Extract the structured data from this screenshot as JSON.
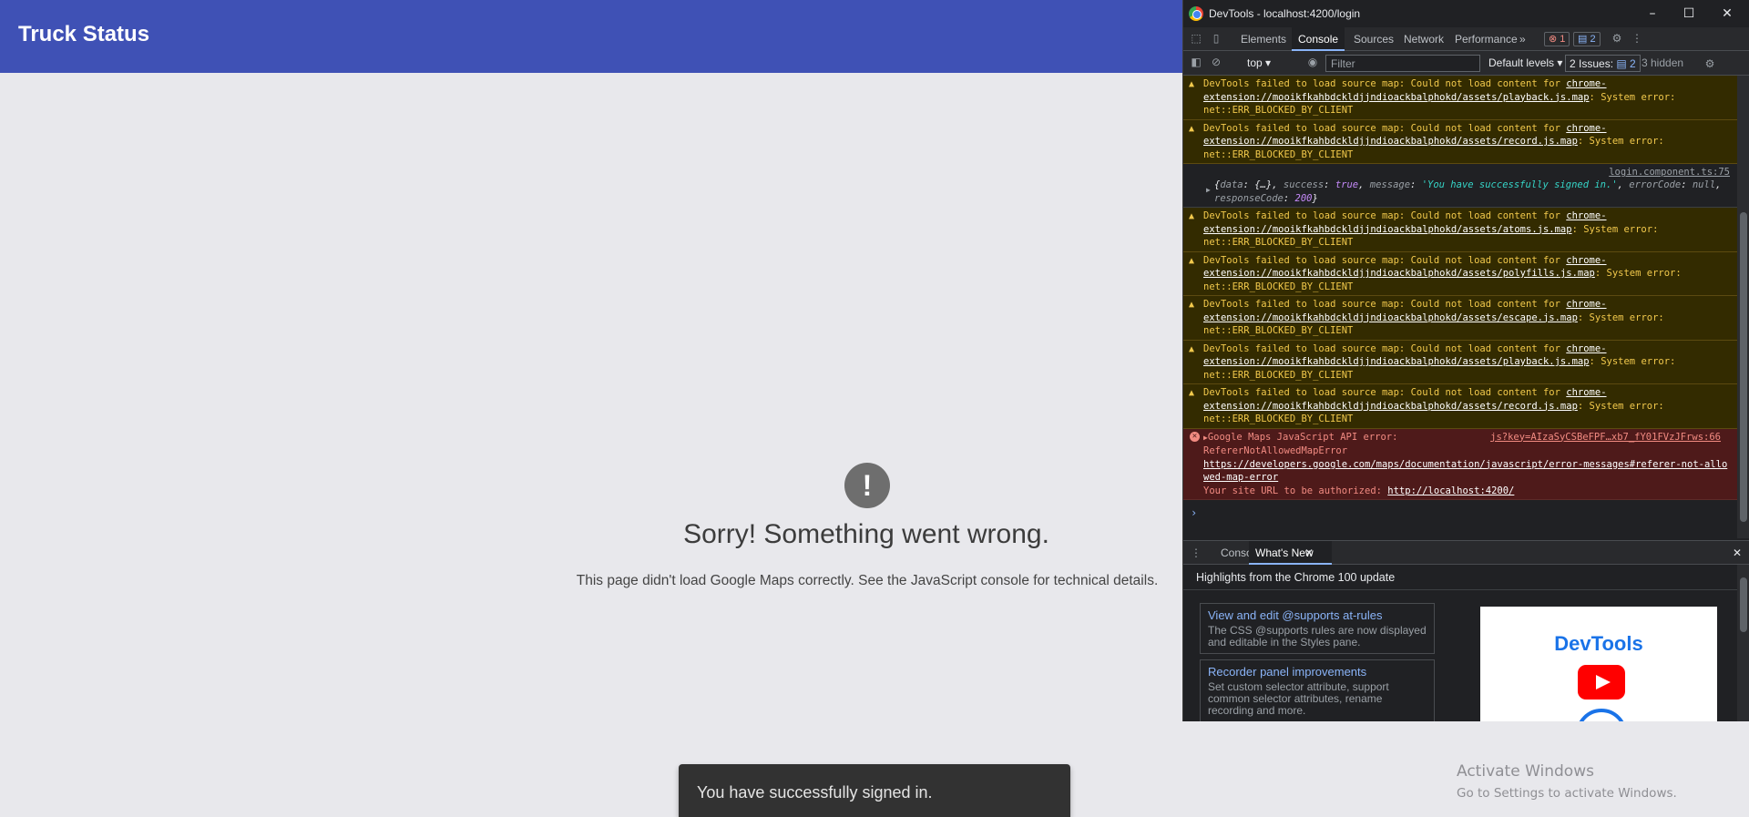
{
  "app": {
    "title": "Truck Status",
    "error_title": "Sorry! Something went wrong.",
    "error_message": "This page didn't load Google Maps correctly. See the JavaScript console for technical details.",
    "error_icon": "!",
    "snackbar": "You have successfully signed in."
  },
  "watermark": {
    "line1": "Activate Windows",
    "line2": "Go to Settings to activate Windows."
  },
  "devtools": {
    "window_title": "DevTools - localhost:4200/login",
    "tabs": [
      "Elements",
      "Console",
      "Sources",
      "Network",
      "Performance"
    ],
    "more_tabs": "»",
    "error_badge": "1",
    "message_badge": "2",
    "toolbar": {
      "context": "top",
      "filter_placeholder": "Filter",
      "levels": "Default levels",
      "issues": "2 Issues:",
      "issues_count": "2",
      "hidden": "3 hidden"
    },
    "warn_prefix": "DevTools failed to load source map: Could not load content for ",
    "warn_suffix": ": System error: net::ERR_BLOCKED_BY_CLIENT",
    "warnings_a": [
      "chrome-extension://mooikfkahbdckldjjndioackbalphokd/assets/playback.js.map",
      "chrome-extension://mooikfkahbdckldjjndioackbalphokd/assets/record.js.map"
    ],
    "log": {
      "source": "login.component.ts:75",
      "k_data": "data",
      "v_data": "{…}",
      "k_success": "success",
      "v_success": "true",
      "k_message": "message",
      "v_message": "'You have successfully signed in.'",
      "k_errorCode": "errorCode",
      "v_errorCode": "null",
      "k_responseCode": "responseCode",
      "v_responseCode": "200"
    },
    "warnings_b": [
      "chrome-extension://mooikfkahbdckldjjndioackbalphokd/assets/atoms.js.map",
      "chrome-extension://mooikfkahbdckldjjndioackbalphokd/assets/polyfills.js.map",
      "chrome-extension://mooikfkahbdckldjjndioackbalphokd/assets/escape.js.map",
      "chrome-extension://mooikfkahbdckldjjndioackbalphokd/assets/playback.js.map",
      "chrome-extension://mooikfkahbdckldjjndioackbalphokd/assets/record.js.map"
    ],
    "error": {
      "title": "Google Maps JavaScript API error:",
      "source": "js?key=AIzaSyCSBeFPF…xb7_fY01FVzJFrws:66",
      "name": "RefererNotAllowedMapError",
      "link": "https://developers.google.com/maps/documentation/javascript/error-messages#referer-not-allowed-map-error",
      "authorize_label": "Your site URL to be authorized: ",
      "authorize_url": "http://localhost:4200/"
    },
    "drawer": {
      "tabs": [
        "Console",
        "What's New"
      ],
      "heading": "Highlights from the Chrome 100 update",
      "cards": [
        {
          "title": "View and edit @supports at-rules",
          "desc": "The CSS @supports rules are now displayed and editable in the Styles pane."
        },
        {
          "title": "Recorder panel improvements",
          "desc": "Set custom selector attribute, support common selector attributes, rename recording and more."
        }
      ],
      "promo_title": "DevTools"
    }
  }
}
